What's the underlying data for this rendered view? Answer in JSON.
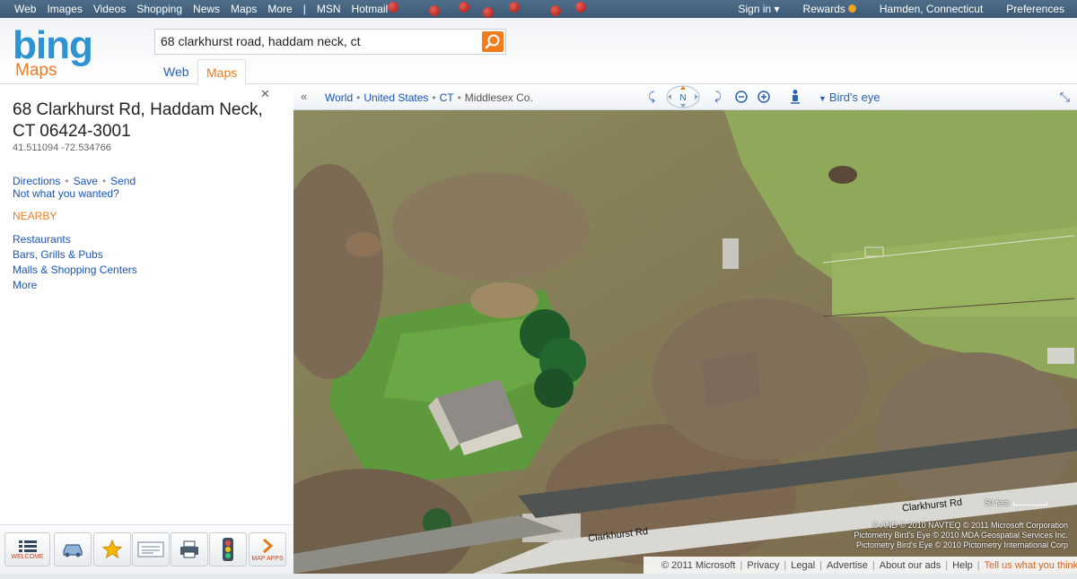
{
  "topbar": {
    "nav": [
      "Web",
      "Images",
      "Videos",
      "Shopping",
      "News",
      "Maps",
      "More",
      "|",
      "MSN",
      "Hotmail"
    ],
    "sign_in": "Sign in ▾",
    "rewards": "Rewards",
    "location": "Hamden, Connecticut",
    "preferences": "Preferences"
  },
  "header": {
    "logo": "bing",
    "product": "Maps",
    "search_value": "68 clarkhurst road, haddam neck, ct",
    "tabs": [
      "Web",
      "Maps"
    ],
    "active_tab": "Maps"
  },
  "result": {
    "address_line1": "68 Clarkhurst Rd, Haddam Neck,",
    "address_line2": "CT 06424-3001",
    "coords": "41.511094 -72.534766",
    "actions": [
      "Directions",
      "Save",
      "Send"
    ],
    "not_wanted": "Not what you wanted?",
    "nearby_title": "NEARBY",
    "nearby": [
      "Restaurants",
      "Bars, Grills & Pubs",
      "Malls & Shopping Centers",
      "More"
    ]
  },
  "toolbar": {
    "welcome": "WELCOME",
    "map_apps": "MAP APPS",
    "buttons": [
      "welcome",
      "directions",
      "favorites",
      "business-card",
      "print",
      "traffic",
      "map-apps"
    ]
  },
  "mapnav": {
    "breadcrumb": [
      "World",
      "United States",
      "CT",
      "Middlesex Co."
    ],
    "compass": "N",
    "view_mode": "Bird's eye"
  },
  "map": {
    "road_label_1": "Clarkhurst Rd",
    "road_label_2": "Clarkhurst Rd",
    "scale": "50 feet",
    "copyright": [
      "© AND  © 2010 NAVTEQ  © 2011 Microsoft Corporation",
      "Pictometry Bird's Eye © 2010 MDA Geospatial Services Inc.",
      "Pictometry Bird's Eye © 2010 Pictometry International Corp"
    ]
  },
  "footer": {
    "items": [
      "© 2011 Microsoft",
      "Privacy",
      "Legal",
      "Advertise",
      "About our ads",
      "Help"
    ],
    "feedback": "Tell us what you think"
  },
  "colors": {
    "accent_orange": "#f07c1d",
    "link_blue": "#1a55b5",
    "bing_blue": "#2d93d3"
  }
}
